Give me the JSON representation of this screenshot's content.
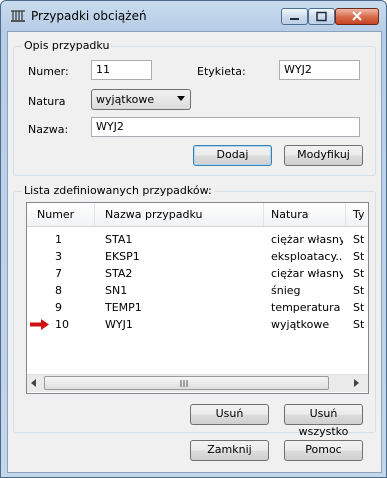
{
  "window": {
    "title": "Przypadki obciążeń"
  },
  "definition": {
    "group_title": "Opis przypadku",
    "number_label": "Numer:",
    "number_value": "11",
    "label_label": "Etykieta:",
    "label_value": "WYJ2",
    "nature_label": "Natura",
    "nature_value": "wyjątkowe",
    "name_label": "Nazwa:",
    "name_value": "WYJ2",
    "add_button": "Dodaj",
    "modify_button": "Modyfikuj"
  },
  "list": {
    "group_title": "Lista zdefiniowanych przypadków:",
    "columns": [
      "Numer",
      "Nazwa przypadku",
      "Natura",
      "Ty"
    ],
    "rows": [
      {
        "num": "1",
        "name": "STA1",
        "nature": "ciężar własny",
        "type": "St"
      },
      {
        "num": "3",
        "name": "EKSP1",
        "nature": "eksploatacy...",
        "type": "St"
      },
      {
        "num": "7",
        "name": "STA2",
        "nature": "ciężar własny",
        "type": "St"
      },
      {
        "num": "8",
        "name": "SN1",
        "nature": "śnieg",
        "type": "St"
      },
      {
        "num": "9",
        "name": "TEMP1",
        "nature": "temperatura",
        "type": "St"
      },
      {
        "num": "10",
        "name": "WYJ1",
        "nature": "wyjątkowe",
        "type": "St"
      }
    ],
    "delete_button": "Usuń",
    "delete_all_button": "Usuń wszystko"
  },
  "footer": {
    "close_button": "Zamknij",
    "help_button": "Pomoc"
  },
  "colors": {
    "marker_arrow": "#cc1111"
  }
}
